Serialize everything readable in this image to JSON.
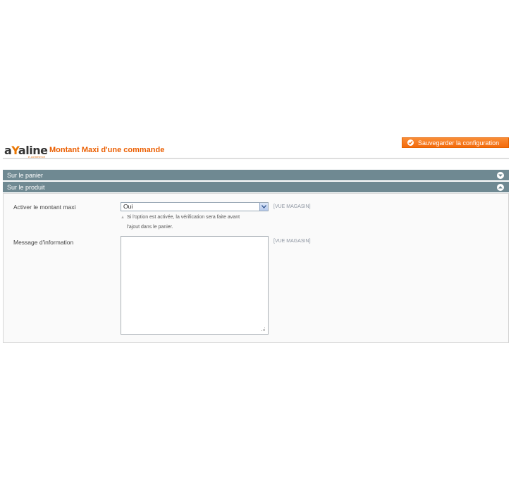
{
  "header": {
    "logo_main": "aYaline",
    "logo_sub": "e-commerce",
    "title": "Montant Maxi d'une commande",
    "save_label": "Sauvegarder la configuration"
  },
  "sections": [
    {
      "label": "Sur le panier",
      "state": "collapsed"
    },
    {
      "label": "Sur le produit",
      "state": "expanded"
    }
  ],
  "fields": {
    "enable": {
      "label": "Activer le montant maxi",
      "value": "Oui",
      "scope": "[VUE MAGASIN]",
      "note_line1": "Si l'option est activée, la vérification sera faite avant",
      "note_line2": "l'ajout dans le panier."
    },
    "message": {
      "label": "Message d'information",
      "value": "",
      "scope": "[VUE MAGASIN]"
    }
  },
  "colors": {
    "accent": "#eb5e00",
    "section_bar": "#6f8992",
    "button": "#f46a0c"
  }
}
